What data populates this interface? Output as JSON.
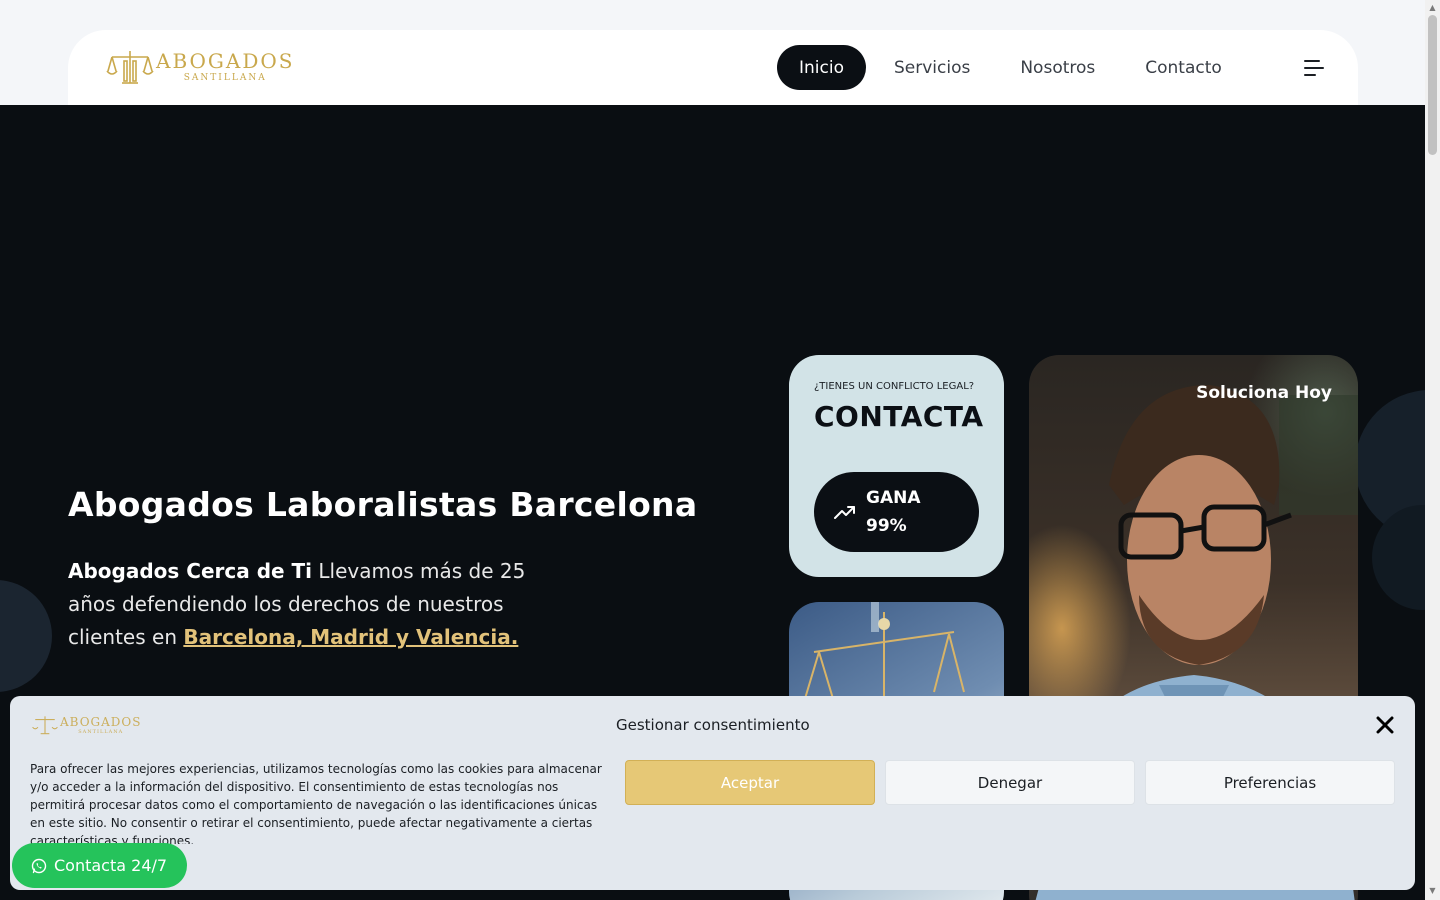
{
  "header": {
    "logo": {
      "name": "ABOGADOS",
      "sub": "SANTILLANA"
    },
    "nav": [
      {
        "label": "Inicio",
        "active": true
      },
      {
        "label": "Servicios",
        "active": false
      },
      {
        "label": "Nosotros",
        "active": false
      },
      {
        "label": "Contacto",
        "active": false
      }
    ],
    "menu_icon": "hamburger-menu-icon"
  },
  "hero": {
    "title": "Abogados Laboralistas Barcelona",
    "lead_bold": "Abogados Cerca de Ti",
    "lead_text": " Llevamos más de 25 años defendiendo los derechos de nuestros clientes en ",
    "lead_link": "Barcelona, Madrid y Valencia.",
    "contact_card": {
      "eyebrow": "¿TIENES UN CONFLICTO LEGAL?",
      "title": "CONTACTA",
      "button_label": "GANA 99%",
      "button_icon": "trending-up-icon"
    },
    "photo_card": {
      "label": "Soluciona Hoy"
    }
  },
  "consent": {
    "title": "Gestionar consentimiento",
    "text": "Para ofrecer las mejores experiencias, utilizamos tecnologías como las cookies para almacenar y/o acceder a la información del dispositivo. El consentimiento de estas tecnologías nos permitirá procesar datos como el comportamiento de navegación o las identificaciones únicas en este sitio. No consentir o retirar el consentimiento, puede afectar negativamente a ciertas características y funciones.",
    "accept_label": "Aceptar",
    "deny_label": "Denegar",
    "prefs_label": "Preferencias"
  },
  "whatsapp": {
    "label": "Contacta 24/7",
    "icon": "whatsapp-icon"
  },
  "colors": {
    "brand_gold": "#c9a84c",
    "hero_bg": "#0a0e12",
    "accept_bg": "#e6c876",
    "whatsapp_green": "#25c35b"
  }
}
